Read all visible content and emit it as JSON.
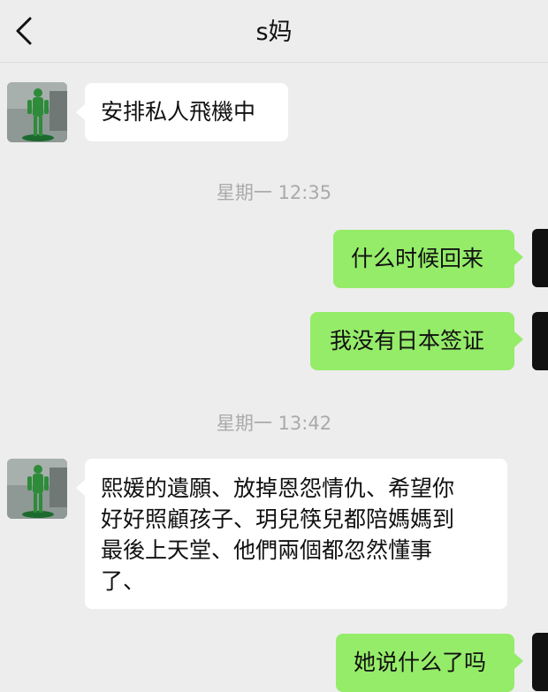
{
  "header": {
    "title": "s妈",
    "back_icon": "chevron-left-icon"
  },
  "messages": [
    {
      "id": "m1",
      "direction": "incoming",
      "text": "安排私人飛機中"
    },
    {
      "id": "t1",
      "type": "timestamp",
      "text": "星期一 12:35"
    },
    {
      "id": "m2",
      "direction": "outgoing",
      "text": "什么时候回来"
    },
    {
      "id": "m3",
      "direction": "outgoing",
      "text": "我没有日本签证"
    },
    {
      "id": "t2",
      "type": "timestamp",
      "text": "星期一 13:42"
    },
    {
      "id": "m4",
      "direction": "incoming",
      "lines": [
        "熙媛的遺願、放掉恩怨情仇、希望你",
        "好好照顧孩子、玥兒筷兒都陪媽媽到",
        "最後上天堂、他們兩個都忽然懂事",
        "了、"
      ]
    },
    {
      "id": "m5",
      "direction": "outgoing",
      "text": "她说什么了吗"
    }
  ],
  "colors": {
    "background": "#ededed",
    "incoming_bubble": "#ffffff",
    "outgoing_bubble": "#95ec69",
    "timestamp_text": "#aaaaaa"
  }
}
